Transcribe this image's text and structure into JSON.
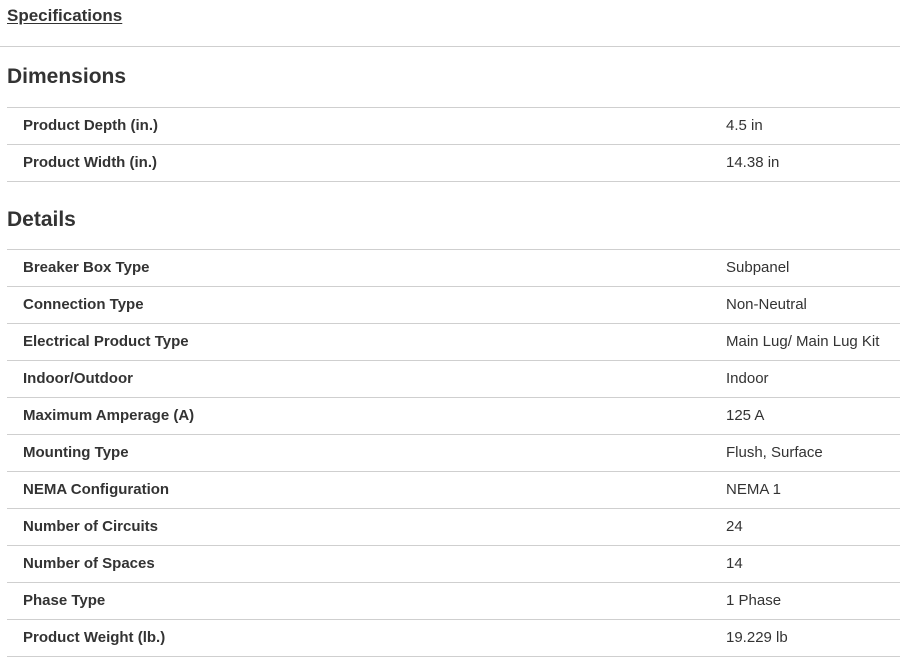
{
  "header": {
    "link_label": "Specifications"
  },
  "sections": [
    {
      "title": "Dimensions",
      "rows": [
        {
          "label": "Product Depth (in.)",
          "value": "4.5 in"
        },
        {
          "label": "Product Width (in.)",
          "value": "14.38 in"
        }
      ]
    },
    {
      "title": "Details",
      "rows": [
        {
          "label": "Breaker Box Type",
          "value": "Subpanel"
        },
        {
          "label": "Connection Type",
          "value": "Non-Neutral"
        },
        {
          "label": "Electrical Product Type",
          "value": "Main Lug/ Main Lug Kit"
        },
        {
          "label": "Indoor/Outdoor",
          "value": "Indoor"
        },
        {
          "label": "Maximum Amperage (A)",
          "value": "125 A"
        },
        {
          "label": "Mounting Type",
          "value": "Flush, Surface"
        },
        {
          "label": "NEMA Configuration",
          "value": "NEMA 1"
        },
        {
          "label": "Number of Circuits",
          "value": "24"
        },
        {
          "label": "Number of Spaces",
          "value": "14"
        },
        {
          "label": "Phase Type",
          "value": "1 Phase"
        },
        {
          "label": "Product Weight (lb.)",
          "value": "19.229 lb"
        }
      ]
    }
  ]
}
